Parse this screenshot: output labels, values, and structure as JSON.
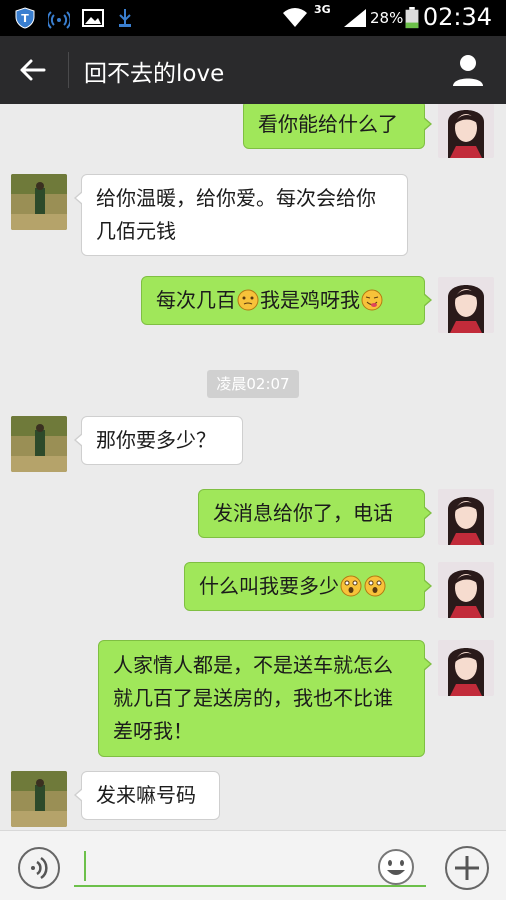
{
  "status_bar": {
    "network": "3G",
    "battery": "28%",
    "time": "02:34"
  },
  "header": {
    "title": "回不去的love"
  },
  "messages": [
    {
      "side": "out",
      "text": "看你能给什么了"
    },
    {
      "side": "in",
      "text": "给你温暖，给你爱。每次会给你几佰元钱"
    },
    {
      "side": "out",
      "text_before": "每次几百",
      "text_mid": "我是鸡呀我",
      "text_after": ""
    },
    {
      "side": "time",
      "text": "凌晨02:07"
    },
    {
      "side": "in",
      "text": "那你要多少？"
    },
    {
      "side": "out",
      "text": "发消息给你了，电话"
    },
    {
      "side": "out",
      "text": "什么叫我要多少"
    },
    {
      "side": "out",
      "text": "人家情人都是，不是送车就怎么就几百了是送房的，我也不比谁差呀我！"
    },
    {
      "side": "in",
      "text": "发来嘛号码"
    }
  ],
  "input_bar": {
    "value": ""
  },
  "colors": {
    "outgoing_bubble": "#a0e75a",
    "incoming_bubble": "#ffffff",
    "title_bar": "#2a2a2c",
    "accent": "#6cc04a"
  },
  "icons": {
    "status_left": [
      "shield-icon",
      "wifi-signal-icon",
      "image-icon",
      "usb-icon"
    ],
    "status_right": [
      "wifi-icon",
      "cell-signal-icon",
      "battery-icon"
    ],
    "header": [
      "back-arrow-icon",
      "profile-icon"
    ],
    "input": [
      "voice-icon",
      "emoji-icon",
      "plus-icon"
    ]
  }
}
